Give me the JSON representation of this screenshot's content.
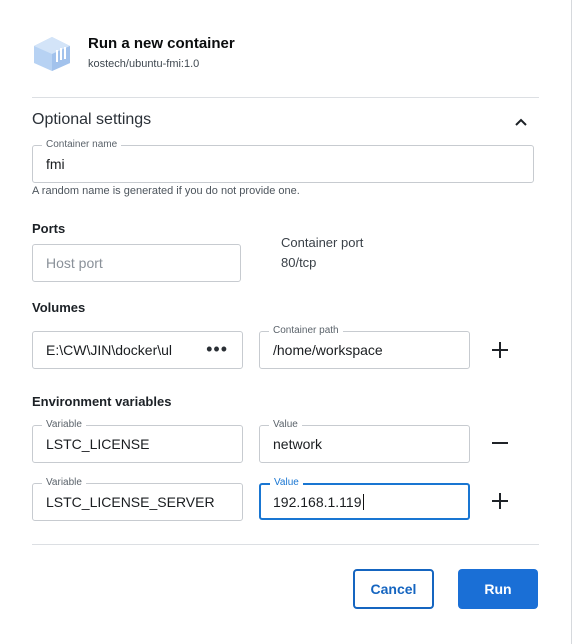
{
  "header": {
    "title": "Run a new container",
    "image": "kostech/ubuntu-fmi:1.0",
    "icon": "docker-whale-icon"
  },
  "optional": {
    "title": "Optional settings",
    "container_name": {
      "label": "Container name",
      "value": "fmi",
      "helper": "A random name is generated if you do not provide one."
    }
  },
  "ports": {
    "title": "Ports",
    "host_port_placeholder": "Host port",
    "container_port_label": "Container port",
    "container_port_value": "80/tcp"
  },
  "volumes": {
    "title": "Volumes",
    "host_path": "E:\\CW\\JIN\\docker\\ul",
    "container_path_label": "Container path",
    "container_path_value": "/home/workspace"
  },
  "env": {
    "title": "Environment variables",
    "rows": [
      {
        "var_label": "Variable",
        "var_value": "LSTC_LICENSE",
        "val_label": "Value",
        "val_value": "network"
      },
      {
        "var_label": "Variable",
        "var_value": "LSTC_LICENSE_SERVER",
        "val_label": "Value",
        "val_value": "192.168.1.119"
      }
    ]
  },
  "footer": {
    "cancel_label": "Cancel",
    "run_label": "Run"
  },
  "colors": {
    "accent": "#1a6fd6",
    "whale": "#aecbf0"
  }
}
